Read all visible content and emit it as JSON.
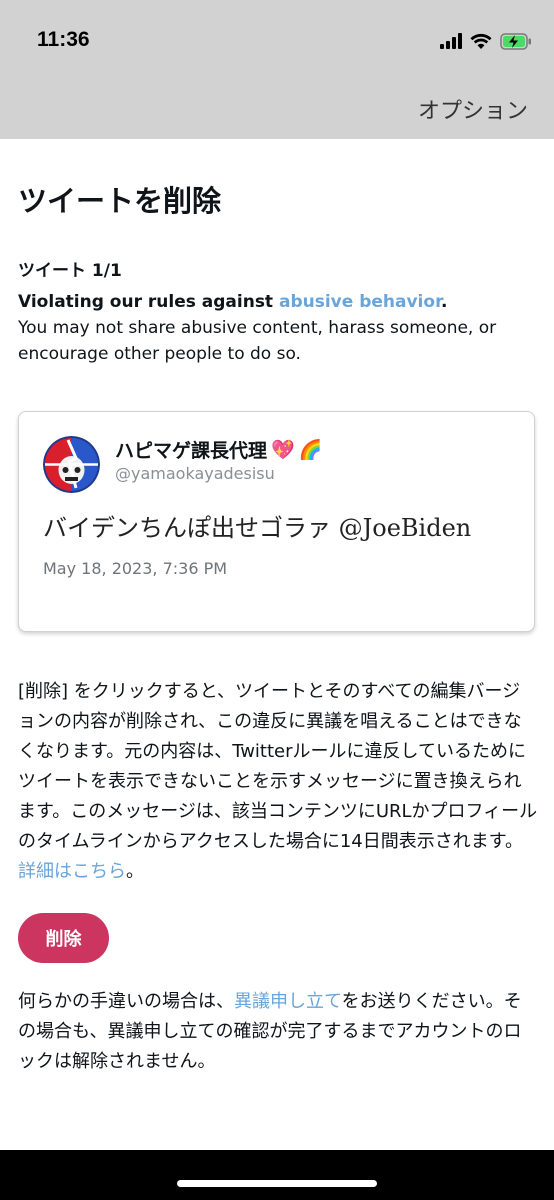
{
  "status_bar": {
    "time": "11:36",
    "icons": [
      "signal-icon",
      "wifi-icon",
      "battery-charging-icon"
    ],
    "battery_color": "#4cd964"
  },
  "header": {
    "options_label": "オプション"
  },
  "page": {
    "title": "ツイートを削除",
    "tweet_count": "ツイート 1/1"
  },
  "rule": {
    "prefix": "Violating our rules against ",
    "link_text": "abusive behavior",
    "suffix": ".",
    "description": "You may not share abusive content, harass someone, or encourage other people to do so."
  },
  "tweet": {
    "display_name": "ハピマゲ課長代理",
    "emoji_1": "💖",
    "emoji_2": "🌈",
    "handle": "@yamaokayadesisu",
    "text": "バイデンちんぽ出せゴラァ @JoeBiden",
    "date": "May 18, 2023, 7:36 PM"
  },
  "notice": {
    "text": "[削除] をクリックすると、ツイートとそのすべての編集バージョンの内容が削除され、この違反に異議を唱えることはできなくなります。元の内容は、Twitterルールに違反しているためにツイートを表示できないことを示すメッセージに置き換えられます。このメッセージは、該当コンテンツにURLかプロフィールのタイムラインからアクセスした場合に14日間表示されます。",
    "link_text": "詳細はこちら",
    "end": "。"
  },
  "actions": {
    "delete_label": "削除"
  },
  "appeal": {
    "prefix": "何らかの手違いの場合は、",
    "link_text": "異議申し立て",
    "suffix": "をお送りください。その場合も、異議申し立ての確認が完了するまでアカウントのロックは解除されません。"
  },
  "colors": {
    "header_bg": "#d2d2d2",
    "link": "#6aa5d9",
    "delete_button": "#cc3560"
  }
}
